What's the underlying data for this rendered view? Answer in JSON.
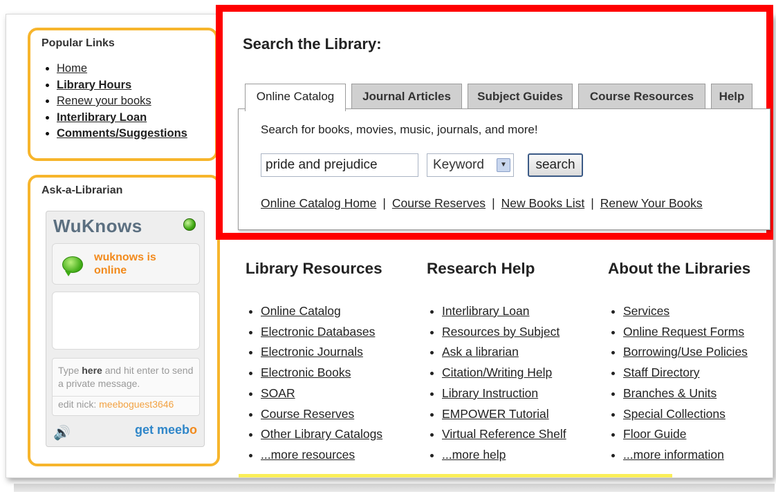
{
  "popular_links": {
    "title": "Popular Links",
    "items": [
      {
        "label": "Home",
        "bold": false
      },
      {
        "label": "Library Hours",
        "bold": true
      },
      {
        "label": "Renew your books",
        "bold": false
      },
      {
        "label": "Interlibrary Loan",
        "bold": true
      },
      {
        "label": "Comments/Suggestions",
        "bold": true
      }
    ]
  },
  "ask_librarian": {
    "title": "Ask-a-Librarian",
    "widget": {
      "title": "WuKnows",
      "status": "wuknows is online",
      "hint_pre": "Type ",
      "hint_bold": "here",
      "hint_post": " and hit enter to send a private message.",
      "edit_nick_label": "edit nick:",
      "nick": "meeboguest3646",
      "brand_get": "get meeb",
      "brand_o": "o"
    }
  },
  "search": {
    "heading": "Search the Library:",
    "tabs": [
      "Online Catalog",
      "Journal Articles",
      "Subject Guides",
      "Course Resources",
      "Help"
    ],
    "active_tab": "Online Catalog",
    "description": "Search for books, movies, music, journals, and more!",
    "query": "pride and prejudice",
    "field": "Keyword",
    "button": "search",
    "links": [
      "Online Catalog Home",
      "Course Reserves",
      "New Books List",
      "Renew Your Books"
    ],
    "separator": "|"
  },
  "columns": [
    {
      "heading": "Library Resources",
      "items": [
        "Online Catalog",
        "Electronic Databases",
        "Electronic Journals",
        "Electronic Books",
        "SOAR",
        "Course Reserves",
        "Other Library Catalogs",
        "...more resources"
      ]
    },
    {
      "heading": "Research Help",
      "items": [
        "Interlibrary Loan",
        "Resources by Subject",
        "Ask a librarian",
        "Citation/Writing Help",
        "Library Instruction",
        "EMPOWER Tutorial",
        "Virtual Reference Shelf",
        "...more help"
      ]
    },
    {
      "heading": "About the Libraries",
      "items": [
        "Services",
        "Online Request Forms",
        "Borrowing/Use Policies",
        "Staff Directory",
        "Branches & Units",
        "Special Collections",
        "Floor Guide",
        "...more information"
      ]
    }
  ],
  "colors": {
    "highlight_border": "#ff0000",
    "box_border": "#f7b52c",
    "status_text": "#f28a1c",
    "meebo_blue": "#2f86c9"
  },
  "icons": [
    "green-status-icon",
    "chat-bubble-icon",
    "speaker-icon",
    "dropdown-arrow-icon"
  ]
}
